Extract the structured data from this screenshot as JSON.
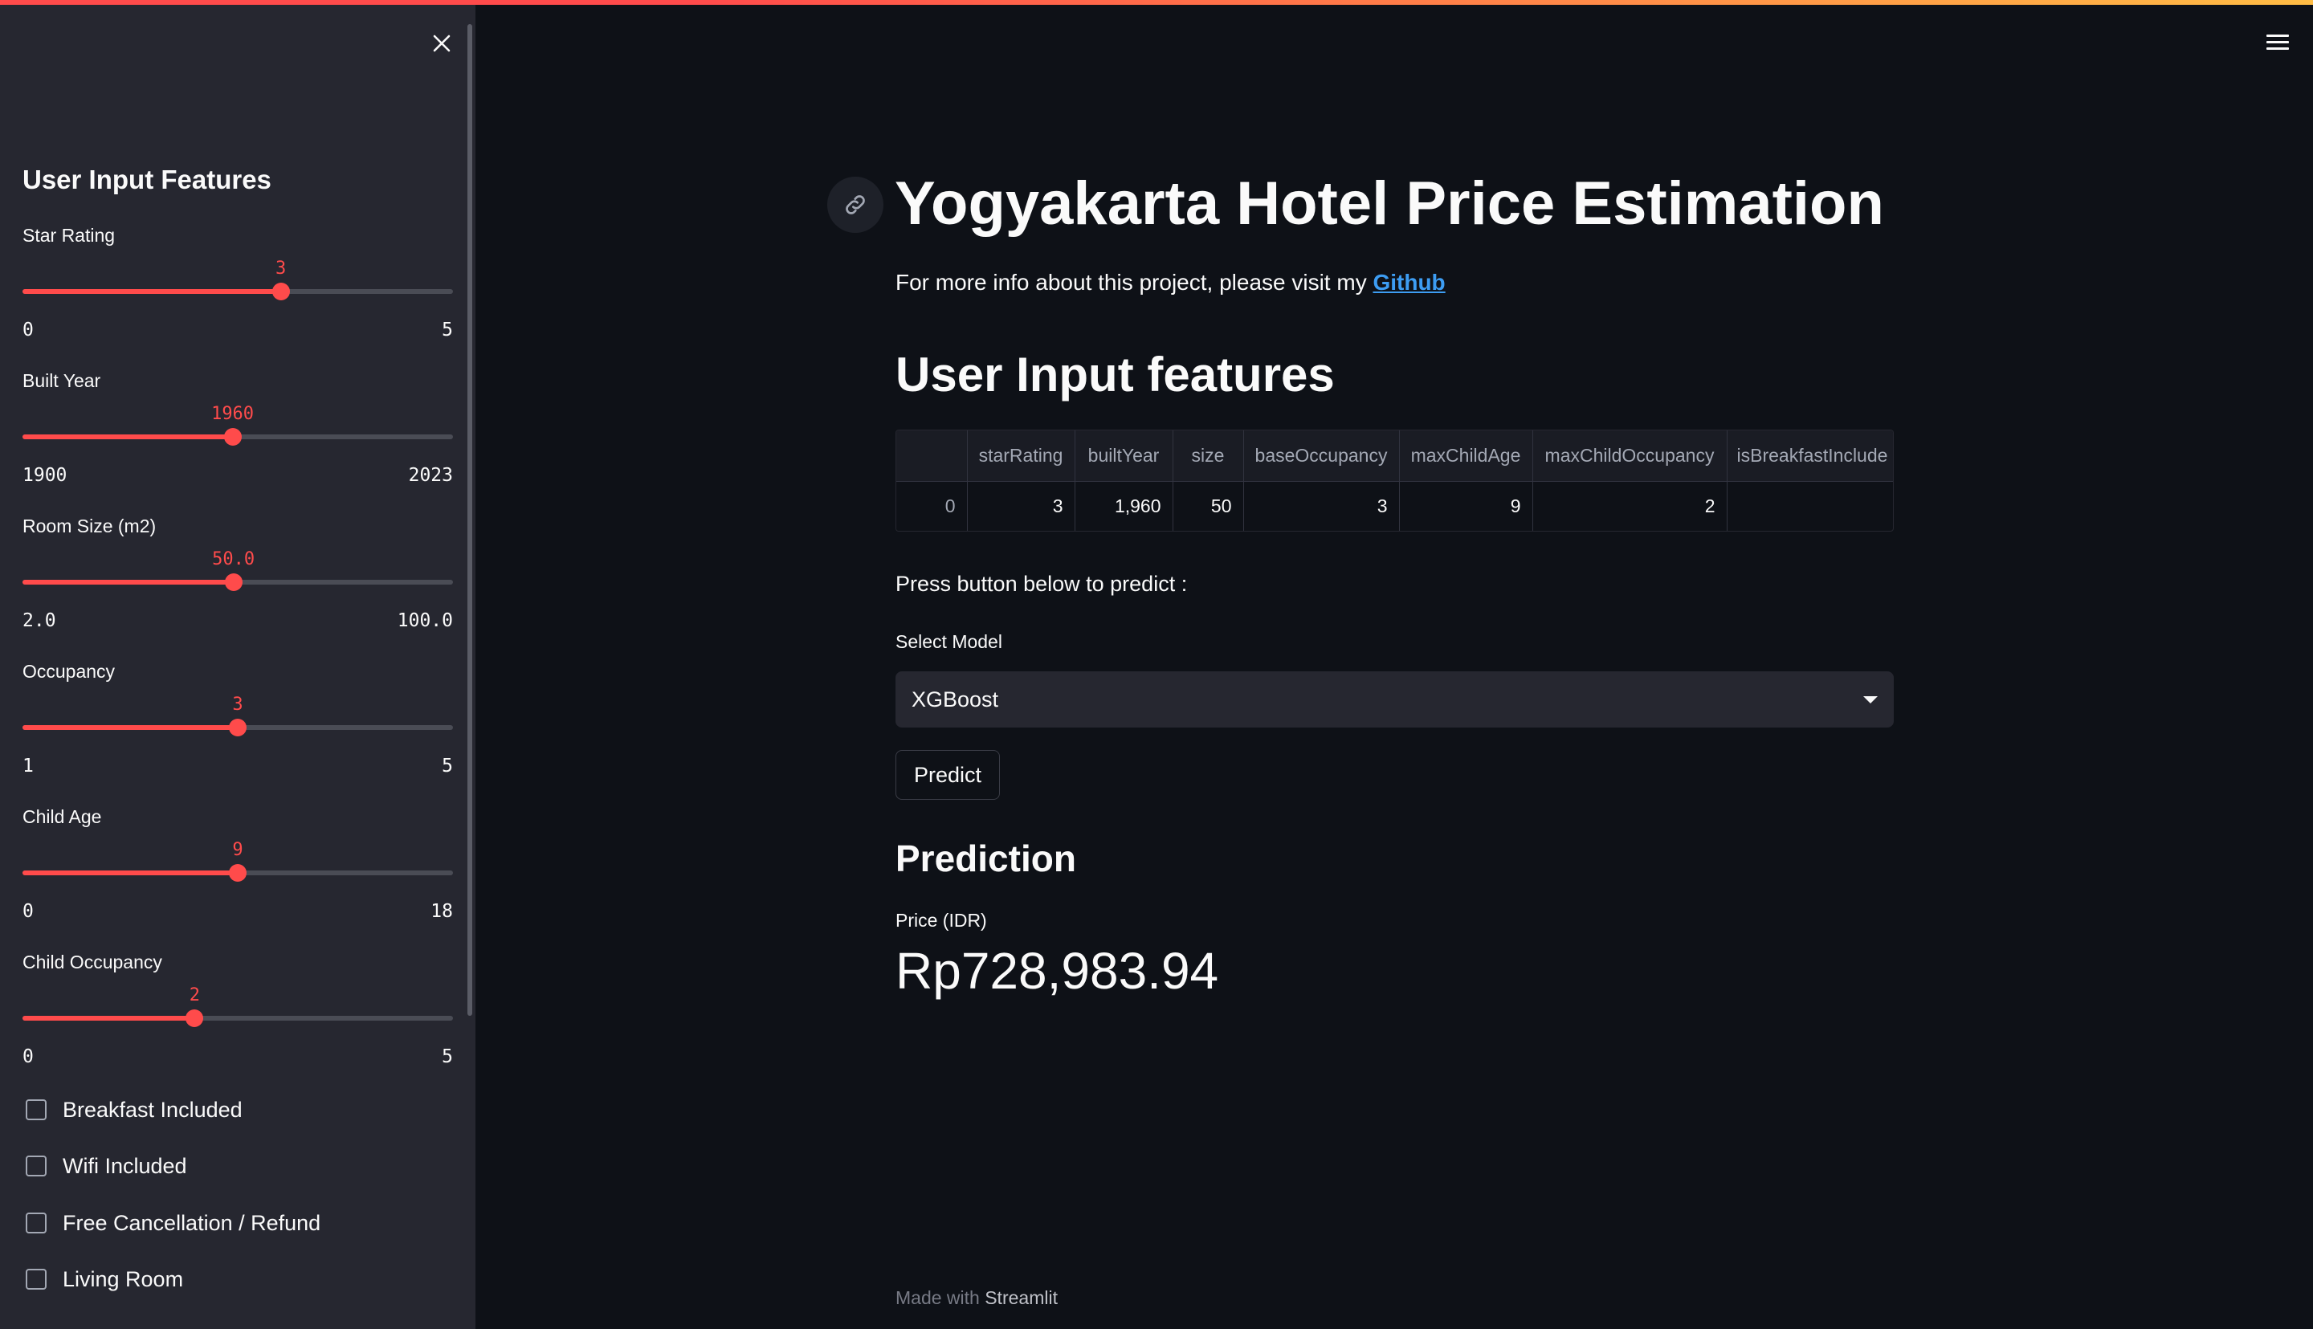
{
  "sidebar": {
    "title": "User Input Features",
    "sliders": [
      {
        "label": "Star Rating",
        "value": "3",
        "min": "0",
        "max": "5",
        "fraction": 0.6
      },
      {
        "label": "Built Year",
        "value": "1960",
        "min": "1900",
        "max": "2023",
        "fraction": 0.488
      },
      {
        "label": "Room Size (m2)",
        "value": "50.0",
        "min": "2.0",
        "max": "100.0",
        "fraction": 0.49
      },
      {
        "label": "Occupancy",
        "value": "3",
        "min": "1",
        "max": "5",
        "fraction": 0.5
      },
      {
        "label": "Child Age",
        "value": "9",
        "min": "0",
        "max": "18",
        "fraction": 0.5
      },
      {
        "label": "Child Occupancy",
        "value": "2",
        "min": "0",
        "max": "5",
        "fraction": 0.4
      }
    ],
    "checkboxes": [
      {
        "label": "Breakfast Included",
        "checked": false
      },
      {
        "label": "Wifi Included",
        "checked": false
      },
      {
        "label": "Free Cancellation / Refund",
        "checked": false
      },
      {
        "label": "Living Room",
        "checked": false
      }
    ]
  },
  "main": {
    "title": "Yogyakarta Hotel Price Estimation",
    "intro_prefix": "For more info about this project, please visit my ",
    "intro_link": "Github",
    "features_header": "User Input features",
    "table": {
      "columns": [
        "",
        "starRating",
        "builtYear",
        "size",
        "baseOccupancy",
        "maxChildAge",
        "maxChildOccupancy",
        "isBreakfastInclude"
      ],
      "rows": [
        [
          "0",
          "3",
          "1,960",
          "50",
          "3",
          "9",
          "2",
          ""
        ]
      ]
    },
    "press_text": "Press button below to predict :",
    "select_label": "Select Model",
    "select_value": "XGBoost",
    "predict_label": "Predict",
    "prediction_header": "Prediction",
    "metric_label": "Price (IDR)",
    "metric_value": "Rp728,983.94",
    "footer_prefix": "Made with ",
    "footer_brand": "Streamlit"
  },
  "colors": {
    "accent": "#ff4b4b",
    "background": "#0e1117",
    "sidebar": "#262730",
    "link": "#3d9df3"
  }
}
